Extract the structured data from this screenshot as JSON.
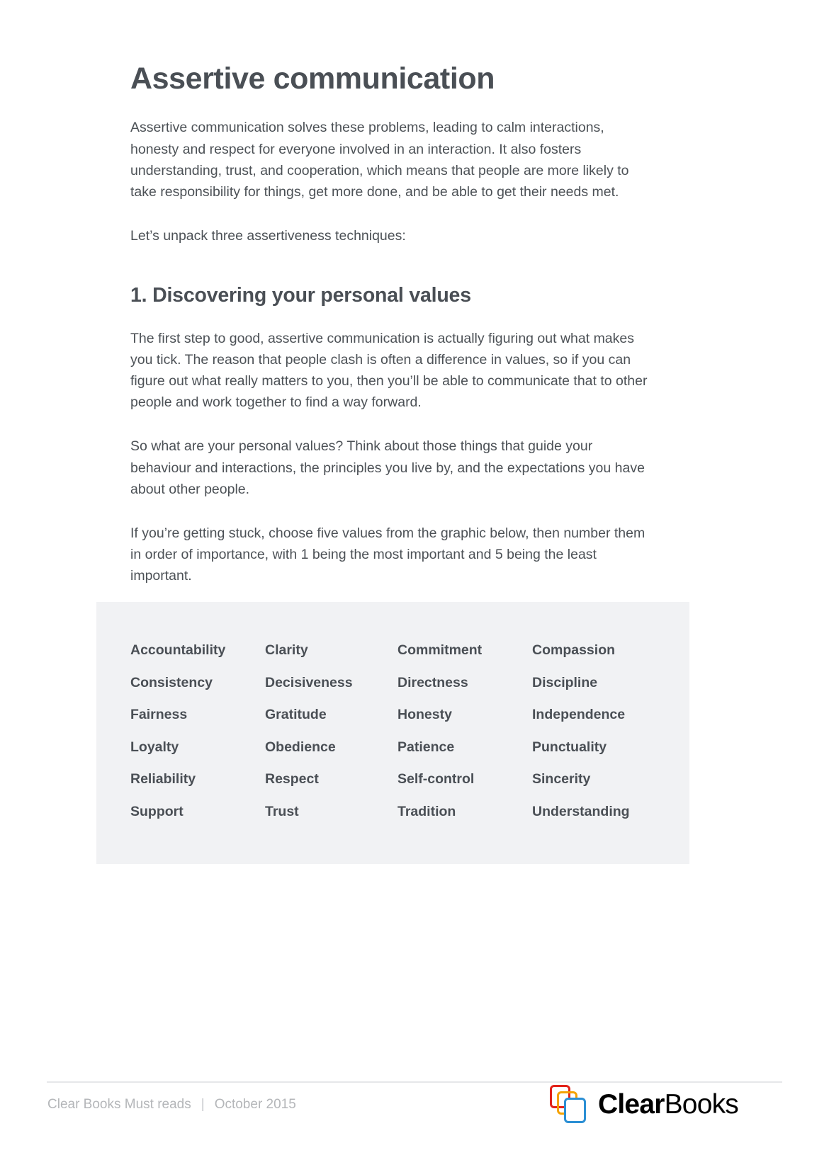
{
  "document": {
    "title": "Assertive communication",
    "intro_paragraph": "Assertive communication solves these problems, leading to calm interactions, honesty and respect for everyone involved in an interaction. It also fosters understanding, trust, and cooperation, which means that people are more likely to take responsibility for things, get more done, and be able to get their needs met.",
    "lead_in": "Let’s unpack three assertiveness techniques:",
    "section": {
      "heading": "1. Discovering your personal values",
      "paragraphs": [
        "The first step to good, assertive communication is actually figuring out what makes you tick. The reason that people clash is often a difference in values, so if you can figure out what really matters to you, then you’ll be able to communicate that to other people and work together to find a way forward.",
        "So what are your personal values? Think about those things that guide your behaviour and interactions, the principles you live by, and the expectations you have about other people.",
        "If you’re getting stuck, choose five values from the graphic below, then number them in order of importance, with 1 being the most important and 5 being the least important."
      ]
    }
  },
  "values_panel": {
    "background_color": "#f1f2f4",
    "columns": 4,
    "rows": 6,
    "items": [
      "Accountability",
      "Clarity",
      "Commitment",
      "Compassion",
      "Consistency",
      "Decisiveness",
      "Directness",
      "Discipline",
      "Fairness",
      "Gratitude",
      "Honesty",
      "Independence",
      "Loyalty",
      "Obedience",
      "Patience",
      "Punctuality",
      "Reliability",
      "Respect",
      "Self-control",
      "Sincerity",
      "Support",
      "Trust",
      "Tradition",
      "Understanding"
    ]
  },
  "footer": {
    "publication": "Clear Books Must reads",
    "separator": "|",
    "date": "October 2015",
    "logo": {
      "name_bold": "Clear",
      "name_light": "Books",
      "mark_colors": {
        "red": "#e2231a",
        "orange": "#f5a200",
        "blue": "#2b8fd4"
      }
    }
  },
  "theme": {
    "text_color": "#4c5156",
    "heading_color": "#4a4f55",
    "muted_color": "#b4b6b9",
    "rule_color": "#e6e7e9",
    "page_background": "#ffffff"
  }
}
